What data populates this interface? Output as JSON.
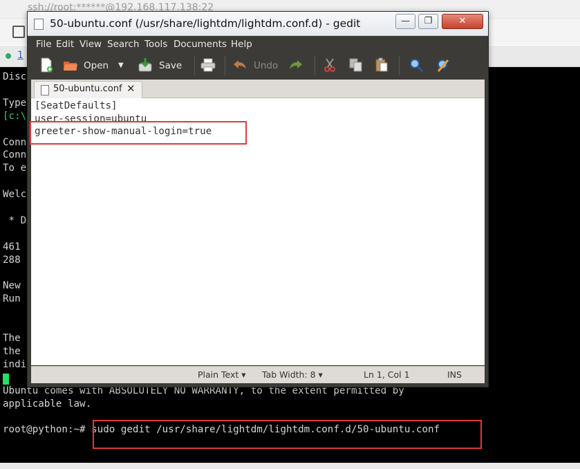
{
  "background": {
    "session_title": "ssh://root:******@192.168.117.138:22",
    "tab_number": "1",
    "terminal_lines": [
      "Disc",
      "",
      "Type",
      "[c:\\",
      "",
      "Conn",
      "Conn",
      "To e",
      "",
      "Welc",
      "",
      " * D",
      "",
      "461",
      "288",
      "",
      "New",
      "Run",
      "",
      "",
      "The",
      "the",
      "indi",
      "",
      "Ubuntu comes with ABSOLUTELY NO WARRANTY, to the extent permitted by",
      "applicable law.",
      "",
      "root@python:~# sudo gedit /usr/share/lightdm/lightdm.conf.d/50-ubuntu.conf"
    ]
  },
  "gedit": {
    "window_title": "50-ubuntu.conf (/usr/share/lightdm/lightdm.conf.d) - gedit",
    "window_buttons": {
      "minimize": "—",
      "maximize": "❐",
      "close": "✕"
    },
    "menu": [
      "File",
      "Edit",
      "View",
      "Search",
      "Tools",
      "Documents",
      "Help"
    ],
    "toolbar": {
      "open_label": "Open",
      "save_label": "Save",
      "undo_label": "Undo"
    },
    "tab": {
      "label": "50-ubuntu.conf",
      "close": "✕"
    },
    "editor_lines": [
      "[SeatDefaults]",
      "user-session=ubuntu",
      "greeter-show-manual-login=true"
    ],
    "status": {
      "language": "Plain Text ▾",
      "tab_width": "Tab Width: 8 ▾",
      "position": "Ln 1, Col 1",
      "mode": "INS"
    }
  },
  "colors": {
    "annotation": "#e03a3a",
    "terminal_bg": "#000000",
    "prompt_green": "#3ad36a",
    "toolbar_bg": "#3c3b37"
  }
}
